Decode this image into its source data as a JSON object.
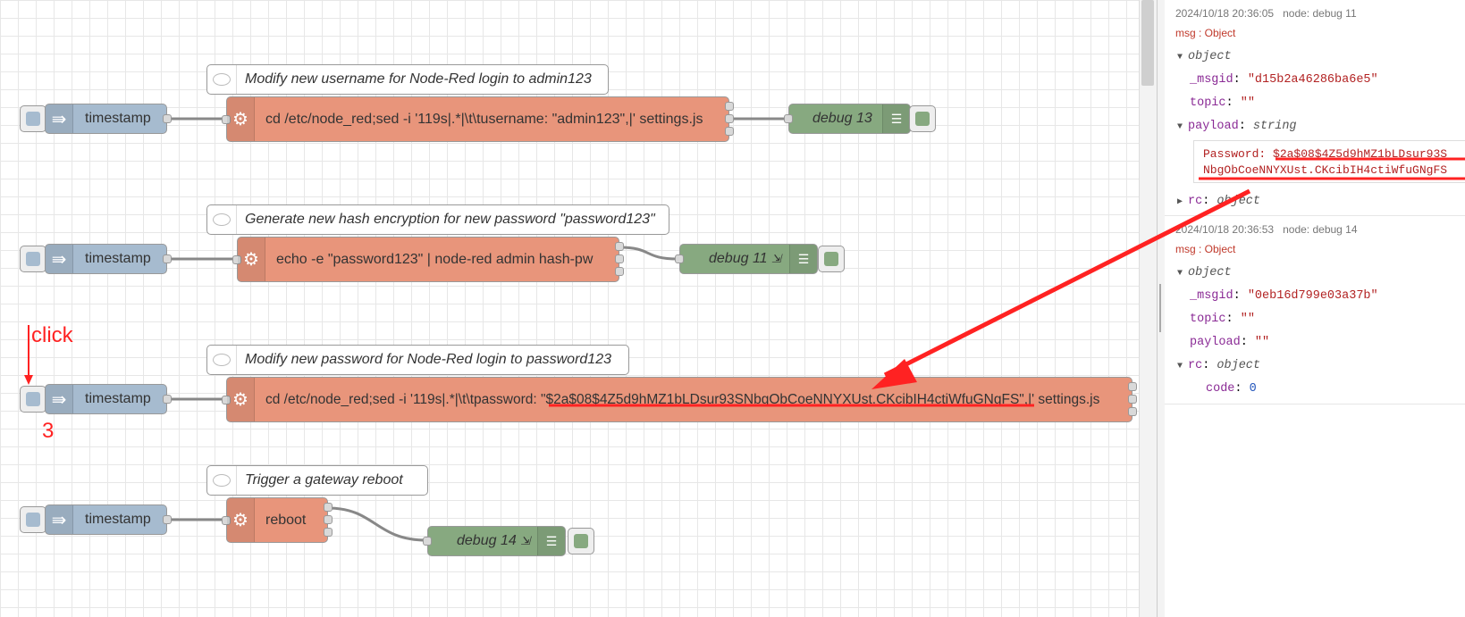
{
  "flow": {
    "comments": [
      "Modify new username for Node-Red login to admin123",
      "Generate new hash encryption for new password \"password123\"",
      "Modify new password for Node-Red login to password123",
      "Trigger a gateway reboot"
    ],
    "inject_label": "timestamp",
    "exec_nodes": [
      "cd /etc/node_red;sed -i '119s|.*|\\t\\tusername: \"admin123\",|' settings.js",
      "echo -e \"password123\" | node-red admin hash-pw",
      "cd /etc/node_red;sed -i '119s|.*|\\t\\tpassword: \"$2a$08$4Z5d9hMZ1bLDsur93SNbgObCoeNNYXUst.CKcibIH4ctiWfuGNgFS\",|' settings.js",
      "reboot"
    ],
    "debug_nodes": [
      "debug 13",
      "debug 11",
      "debug 14"
    ],
    "annotations": {
      "click": "click",
      "step": "3"
    }
  },
  "sidebar": {
    "messages": [
      {
        "time": "2024/10/18 20:36:05",
        "node": "node: debug 11",
        "type": "msg : Object",
        "root": "object",
        "msgid_key": "_msgid",
        "msgid": "\"d15b2a46286ba6e5\"",
        "topic_key": "topic",
        "topic": "\"\"",
        "payload_key": "payload",
        "payload_type": "string",
        "payload_line1": "Password: $2a$08$4Z5d9hMZ1bLDsur93S",
        "payload_line2": "NbgObCoeNNYXUst.CKcibIH4ctiWfuGNgFS",
        "rc_key": "rc",
        "rc_type": "object"
      },
      {
        "time": "2024/10/18 20:36:53",
        "node": "node: debug 14",
        "type": "msg : Object",
        "root": "object",
        "msgid_key": "_msgid",
        "msgid": "\"0eb16d799e03a37b\"",
        "topic_key": "topic",
        "topic": "\"\"",
        "payload_key": "payload",
        "payload": "\"\"",
        "rc_key": "rc",
        "rc_type": "object",
        "code_key": "code",
        "code": "0"
      }
    ]
  },
  "colors": {
    "inject": "#a6bbcf",
    "exec": "#e8957b",
    "debug": "#87a980",
    "annotation": "#ff2222"
  }
}
